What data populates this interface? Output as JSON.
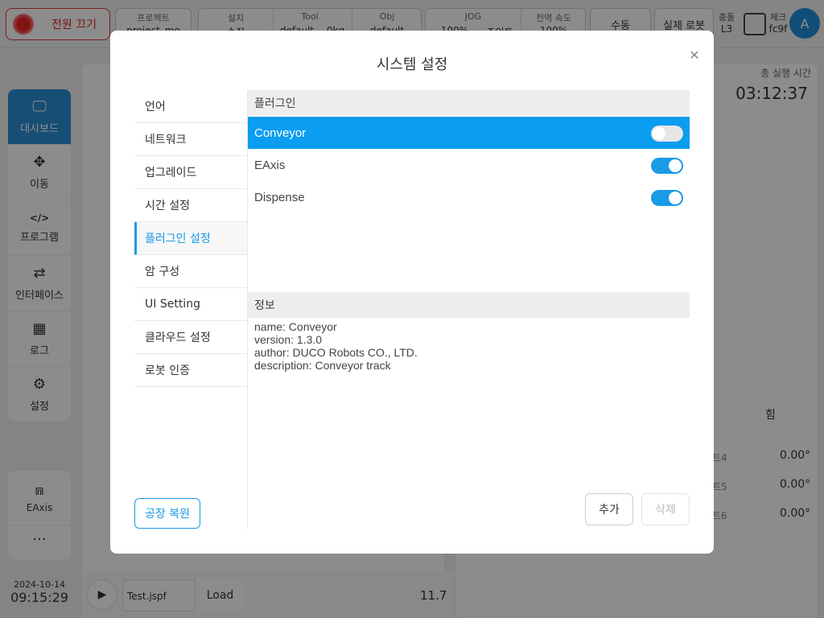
{
  "header": {
    "power_label": "전원 끄기",
    "project_caption": "프로젝트",
    "project_value": "project_mo",
    "install_caption": "설치",
    "install_value": "수집",
    "tool_caption": "Tool",
    "tool_value": "default",
    "tool_weight": "0kg",
    "obj_caption": "Obj",
    "obj_value": "default",
    "jog_caption": "JOG",
    "jog_value": "100%",
    "jog_mode": "조인트",
    "global_speed_caption": "전역 속도",
    "global_speed_value": "100%",
    "manual_label": "수동",
    "real_robot_label": "실제 로봇",
    "collision_caption": "충돌",
    "collision_level": "L3",
    "check_caption": "체크",
    "check_value": "fc9f",
    "avatar_letter": "A"
  },
  "sidebar": {
    "items": [
      {
        "label": "대시보드",
        "icon": "monitor-icon",
        "glyph": "🖵"
      },
      {
        "label": "이동",
        "icon": "move-icon",
        "glyph": "✥"
      },
      {
        "label": "프로그램",
        "icon": "code-icon",
        "glyph": "</>"
      },
      {
        "label": "인터페이스",
        "icon": "swap-icon",
        "glyph": "⇄"
      },
      {
        "label": "로그",
        "icon": "calendar-icon",
        "glyph": "▦"
      },
      {
        "label": "설정",
        "icon": "gear-icon",
        "glyph": "⚙"
      }
    ],
    "eaxis_label": "EAxis",
    "more_glyph": "···"
  },
  "status": {
    "date": "2024-10-14",
    "time": "09:15:29",
    "runtime_caption": "총 실행 시간",
    "runtime_value": "03:12:37"
  },
  "player": {
    "file_name": "Test.jspf",
    "load_label": "Load",
    "speed_value": "11.7"
  },
  "right_panel": {
    "force_label": "힘",
    "joints": [
      {
        "label": "트4",
        "value": "0.00°"
      },
      {
        "label": "트5",
        "value": "0.00°"
      },
      {
        "label": "트6",
        "value": "0.00°"
      }
    ]
  },
  "modal": {
    "title": "시스템 설정",
    "menu": [
      "언어",
      "네트워크",
      "업그레이드",
      "시간 설정",
      "플러그인 설정",
      "암 구성",
      "UI Setting",
      "클라우드 설정",
      "로봇 인증"
    ],
    "active_menu_index": 4,
    "factory_reset_label": "공장 복원",
    "plugins_header": "플러그인",
    "plugins": [
      {
        "name": "Conveyor",
        "enabled": false,
        "selected": true
      },
      {
        "name": "EAxis",
        "enabled": true,
        "selected": false
      },
      {
        "name": "Dispense",
        "enabled": true,
        "selected": false
      }
    ],
    "info_header": "정보",
    "info_lines": [
      "name: Conveyor",
      "version: 1.3.0",
      "author: DUCO Robots CO., LTD.",
      "description: Conveyor track"
    ],
    "add_label": "추가",
    "delete_label": "삭제"
  }
}
